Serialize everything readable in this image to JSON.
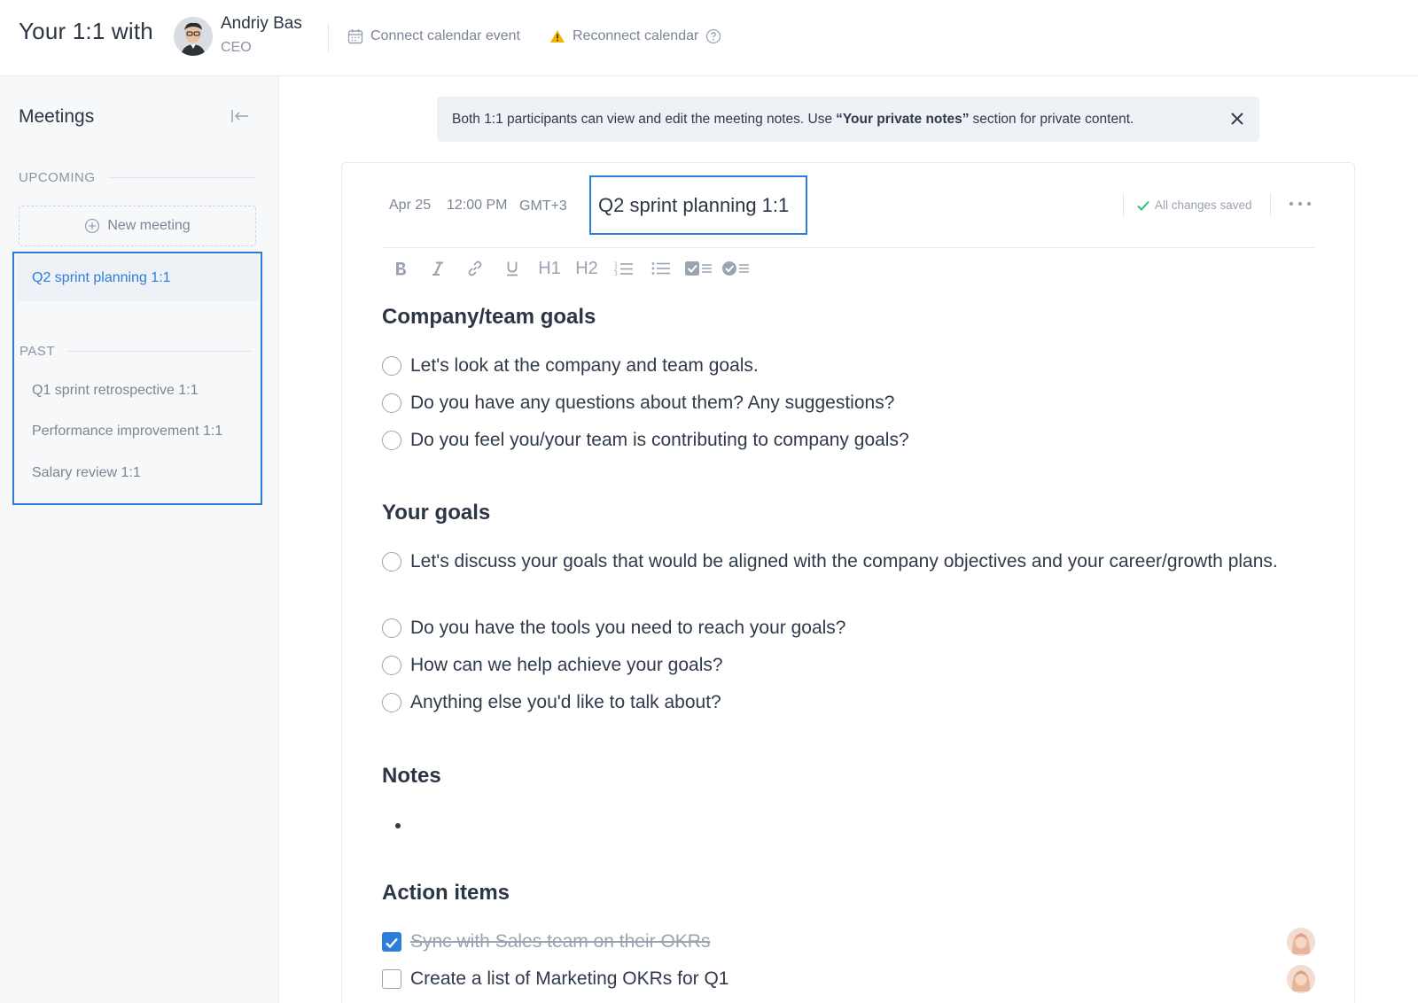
{
  "header": {
    "title": "Your 1:1 with",
    "person_name": "Andriy Bas",
    "person_role": "CEO",
    "connect_label": "Connect calendar event",
    "reconnect_label": "Reconnect calendar"
  },
  "sidebar": {
    "title": "Meetings",
    "upcoming_label": "UPCOMING",
    "new_meeting_label": "New meeting",
    "upcoming": [
      {
        "label": "Q2 sprint planning 1:1"
      }
    ],
    "past_label": "PAST",
    "past": [
      {
        "label": "Q1 sprint retrospective 1:1"
      },
      {
        "label": "Performance improvement 1:1"
      },
      {
        "label": "Salary review 1:1"
      }
    ]
  },
  "banner": {
    "text_before": "Both 1:1 participants can view and edit the meeting notes. Use",
    "bold": "“Your private notes”",
    "text_after": "section for private content."
  },
  "meeting": {
    "date": "Apr 25",
    "time": "12:00 PM",
    "timezone": "GMT+3",
    "title": "Q2 sprint planning 1:1",
    "saved_status": "All changes saved"
  },
  "toolbar": {
    "h1": "H1",
    "h2": "H2"
  },
  "sections": {
    "company_goals": {
      "heading": "Company/team goals",
      "items": [
        "Let's look at the company and team goals.",
        "Do you have any questions about them? Any suggestions?",
        "Do you feel you/your team is contributing to company goals?"
      ]
    },
    "your_goals": {
      "heading": "Your goals",
      "items": [
        "Let's discuss your goals that would be aligned with the company objectives and your career/growth plans.",
        "Do you have the tools you need to reach your goals?",
        "How can we help achieve your goals?",
        "Anything else you'd like to talk about?"
      ]
    },
    "notes": {
      "heading": "Notes"
    },
    "action_items": {
      "heading": "Action items",
      "items": [
        {
          "text": "Sync with Sales team on their OKRs",
          "done": true
        },
        {
          "text": "Create a list of Marketing OKRs for Q1",
          "done": false
        }
      ]
    }
  },
  "colors": {
    "accent": "#2d7ed8",
    "text": "#2f3a4b",
    "muted": "#7b8595",
    "success": "#2fbf71",
    "warning": "#f2b705"
  }
}
